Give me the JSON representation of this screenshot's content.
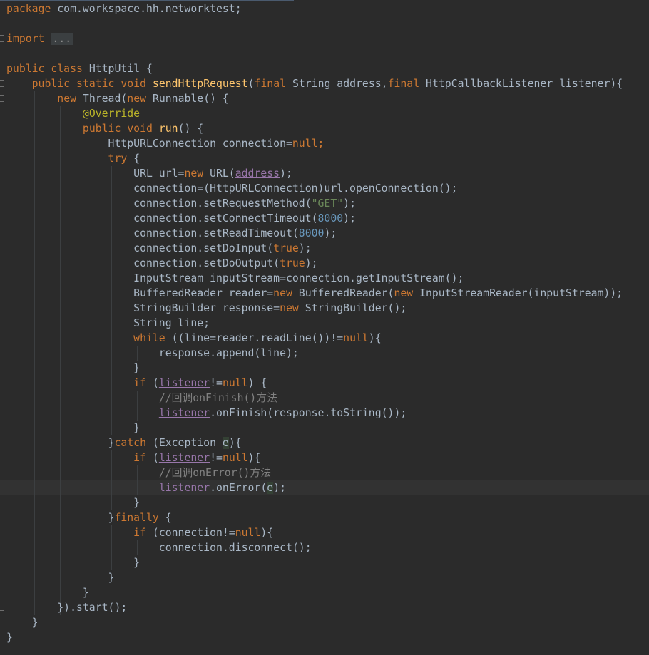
{
  "editor": {
    "theme": "darcula",
    "colors": {
      "background": "#2B2B2B",
      "keyword": "#CC7832",
      "annotation": "#BBB529",
      "number": "#6897BB",
      "string": "#6A8759",
      "comment": "#808080",
      "field": "#9876AA",
      "method_decl": "#FFC66D",
      "plain": "#A9B7C6"
    },
    "caret_line": 32,
    "lines": [
      [
        [
          "kw",
          "package"
        ],
        [
          "p",
          " com.workspace.hh.networktest;"
        ]
      ],
      [],
      [
        [
          "kw",
          "import"
        ],
        [
          "p",
          " "
        ],
        [
          "folded",
          "..."
        ]
      ],
      [],
      [
        [
          "kw",
          "public class"
        ],
        [
          "p",
          " "
        ],
        [
          "squig",
          "HttpUtil"
        ],
        [
          "p",
          " {"
        ]
      ],
      [
        [
          "p",
          "    "
        ],
        [
          "kw",
          "public static void"
        ],
        [
          "p",
          " "
        ],
        [
          "fnsquig",
          "sendHttpRequest"
        ],
        [
          "p",
          "("
        ],
        [
          "kw",
          "final"
        ],
        [
          "p",
          " String address,"
        ],
        [
          "kw",
          "final"
        ],
        [
          "p",
          " HttpCallbackListener listener){"
        ]
      ],
      [
        [
          "p",
          "        "
        ],
        [
          "kw",
          "new"
        ],
        [
          "p",
          " Thread("
        ],
        [
          "kw",
          "new"
        ],
        [
          "p",
          " Runnable() {"
        ]
      ],
      [
        [
          "p",
          "            "
        ],
        [
          "ann",
          "@Override"
        ]
      ],
      [
        [
          "p",
          "            "
        ],
        [
          "kw",
          "public void"
        ],
        [
          "p",
          " "
        ],
        [
          "fn",
          "run"
        ],
        [
          "p",
          "() {"
        ]
      ],
      [
        [
          "p",
          "                HttpURLConnection connection="
        ],
        [
          "kw",
          "null;"
        ]
      ],
      [
        [
          "p",
          "                "
        ],
        [
          "kw",
          "try"
        ],
        [
          "p",
          " {"
        ]
      ],
      [
        [
          "p",
          "                    URL url="
        ],
        [
          "kw",
          "new"
        ],
        [
          "p",
          " URL("
        ],
        [
          "fldul",
          "address"
        ],
        [
          "p",
          ");"
        ]
      ],
      [
        [
          "p",
          "                    connection=(HttpURLConnection)url.openConnection();"
        ]
      ],
      [
        [
          "p",
          "                    connection.setRequestMethod("
        ],
        [
          "str",
          "\"GET\""
        ],
        [
          "p",
          ");"
        ]
      ],
      [
        [
          "p",
          "                    connection.setConnectTimeout("
        ],
        [
          "num",
          "8000"
        ],
        [
          "p",
          ");"
        ]
      ],
      [
        [
          "p",
          "                    connection.setReadTimeout("
        ],
        [
          "num",
          "8000"
        ],
        [
          "p",
          ");"
        ]
      ],
      [
        [
          "p",
          "                    connection.setDoInput("
        ],
        [
          "kw",
          "true"
        ],
        [
          "p",
          ");"
        ]
      ],
      [
        [
          "p",
          "                    connection.setDoOutput("
        ],
        [
          "kw",
          "true"
        ],
        [
          "p",
          ");"
        ]
      ],
      [
        [
          "p",
          "                    InputStream inputStream=connection.getInputStream();"
        ]
      ],
      [
        [
          "p",
          "                    BufferedReader reader="
        ],
        [
          "kw",
          "new"
        ],
        [
          "p",
          " BufferedReader("
        ],
        [
          "kw",
          "new"
        ],
        [
          "p",
          " InputStreamReader(inputStream));"
        ]
      ],
      [
        [
          "p",
          "                    StringBuilder response="
        ],
        [
          "kw",
          "new"
        ],
        [
          "p",
          " StringBuilder();"
        ]
      ],
      [
        [
          "p",
          "                    String line;"
        ]
      ],
      [
        [
          "p",
          "                    "
        ],
        [
          "kw",
          "while"
        ],
        [
          "p",
          " ((line=reader.readLine())!="
        ],
        [
          "kw",
          "null"
        ],
        [
          "p",
          "){"
        ]
      ],
      [
        [
          "p",
          "                        response.append(line);"
        ]
      ],
      [
        [
          "p",
          "                    }"
        ]
      ],
      [
        [
          "p",
          "                    "
        ],
        [
          "kw",
          "if"
        ],
        [
          "p",
          " ("
        ],
        [
          "fldul",
          "listener"
        ],
        [
          "p",
          "!="
        ],
        [
          "kw",
          "null"
        ],
        [
          "p",
          ") {"
        ]
      ],
      [
        [
          "p",
          "                        "
        ],
        [
          "cmt",
          "//回调onFinish()方法"
        ]
      ],
      [
        [
          "p",
          "                        "
        ],
        [
          "fldul",
          "listener"
        ],
        [
          "p",
          ".onFinish(response.toString());"
        ]
      ],
      [
        [
          "p",
          "                    }"
        ]
      ],
      [
        [
          "p",
          "                }"
        ],
        [
          "kw",
          "catch"
        ],
        [
          "p",
          " (Exception "
        ],
        [
          "param",
          "e"
        ],
        [
          "p",
          "){"
        ]
      ],
      [
        [
          "p",
          "                    "
        ],
        [
          "kw",
          "if"
        ],
        [
          "p",
          " ("
        ],
        [
          "fldul",
          "listener"
        ],
        [
          "p",
          "!="
        ],
        [
          "kw",
          "null"
        ],
        [
          "p",
          "){"
        ]
      ],
      [
        [
          "p",
          "                        "
        ],
        [
          "cmt",
          "//回调onError()方法"
        ]
      ],
      [
        [
          "p",
          "                        "
        ],
        [
          "fldul",
          "listener"
        ],
        [
          "p",
          ".onError("
        ],
        [
          "param",
          "e"
        ],
        [
          "p",
          ");"
        ]
      ],
      [
        [
          "p",
          "                    }"
        ]
      ],
      [
        [
          "p",
          "                }"
        ],
        [
          "kw",
          "finally"
        ],
        [
          "p",
          " {"
        ]
      ],
      [
        [
          "p",
          "                    "
        ],
        [
          "kw",
          "if"
        ],
        [
          "p",
          " (connection!="
        ],
        [
          "kw",
          "null"
        ],
        [
          "p",
          "){"
        ]
      ],
      [
        [
          "p",
          "                        connection.disconnect();"
        ]
      ],
      [
        [
          "p",
          "                    }"
        ]
      ],
      [
        [
          "p",
          "                }"
        ]
      ],
      [
        [
          "p",
          "            }"
        ]
      ],
      [
        [
          "p",
          "        }).start();"
        ]
      ],
      [
        [
          "p",
          "    }"
        ]
      ],
      [
        [
          "p",
          "}"
        ]
      ]
    ],
    "guides": [
      {
        "col": 4,
        "from": 6,
        "to": 40
      },
      {
        "col": 8,
        "from": 7,
        "to": 40
      },
      {
        "col": 12,
        "from": 9,
        "to": 38
      },
      {
        "col": 16,
        "from": 11,
        "to": 28
      },
      {
        "col": 16,
        "from": 30,
        "to": 33
      },
      {
        "col": 16,
        "from": 35,
        "to": 37
      },
      {
        "col": 20,
        "from": 23,
        "to": 23
      },
      {
        "col": 20,
        "from": 26,
        "to": 27
      },
      {
        "col": 20,
        "from": 31,
        "to": 32
      },
      {
        "col": 20,
        "from": 36,
        "to": 36
      }
    ],
    "folds": [
      2,
      5,
      6,
      40
    ]
  }
}
